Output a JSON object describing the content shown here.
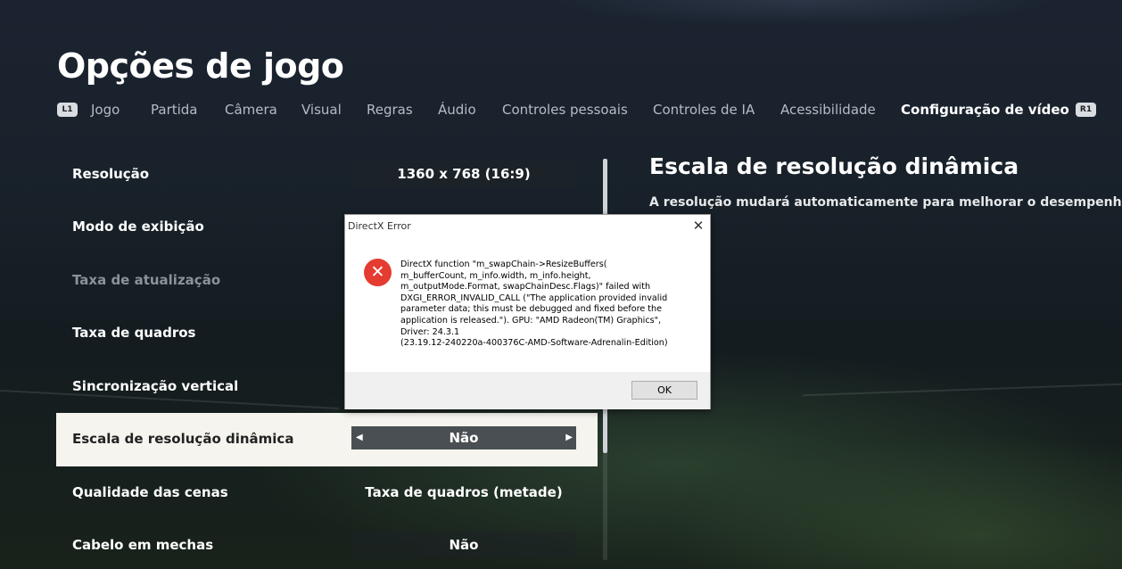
{
  "page": {
    "title": "Opções de jogo"
  },
  "tabs": {
    "left_hint": "L1",
    "right_hint": "R1",
    "items": [
      {
        "label": "Jogo"
      },
      {
        "label": "Partida"
      },
      {
        "label": "Câmera"
      },
      {
        "label": "Visual"
      },
      {
        "label": "Regras"
      },
      {
        "label": "Áudio"
      },
      {
        "label": "Controles pessoais"
      },
      {
        "label": "Controles de IA"
      },
      {
        "label": "Acessibilidade"
      },
      {
        "label": "Configuração de vídeo",
        "active": true
      }
    ]
  },
  "settings": [
    {
      "label": "Resolução",
      "value": "1360 x 768 (16:9)"
    },
    {
      "label": "Modo de exibição",
      "value": ""
    },
    {
      "label": "Taxa de atualização",
      "value": "",
      "dimmed": true
    },
    {
      "label": "Taxa de quadros",
      "value": ""
    },
    {
      "label": "Sincronização vertical",
      "value": ""
    },
    {
      "label": "Escala de resolução dinâmica",
      "value": "Não",
      "selected": true
    },
    {
      "label": "Qualidade das cenas",
      "value": "Taxa de quadros (metade)"
    },
    {
      "label": "Cabelo em mechas",
      "value": "Não"
    }
  ],
  "description": {
    "title": "Escala de resolução dinâmica",
    "text": "A resolução mudará automaticamente para melhorar o desempenho"
  },
  "dialog": {
    "title": "DirectX Error",
    "close_glyph": "✕",
    "icon_glyph": "✕",
    "message": "DirectX function \"m_swapChain->ResizeBuffers(\nm_bufferCount, m_info.width, m_info.height,\nm_outputMode.Format, swapChainDesc.Flags)\" failed with\nDXGI_ERROR_INVALID_CALL (\"The application provided invalid\nparameter data; this must be debugged and fixed before the\napplication is released.\"). GPU: \"AMD Radeon(TM) Graphics\",\nDriver: 24.3.1\n(23.19.12-240220a-400376C-AMD-Software-Adrenalin-Edition)",
    "ok_label": "OK"
  },
  "arrows": {
    "left": "◀",
    "right": "▶"
  },
  "colors": {
    "selected_row_bg": "#f5f4ef",
    "error_red": "#e43c30",
    "dialog_footer": "#f0f0f0"
  }
}
